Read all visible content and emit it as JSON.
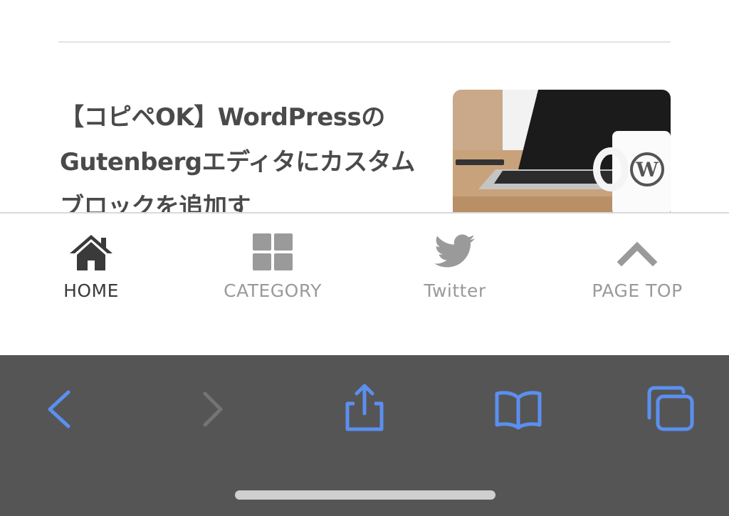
{
  "article": {
    "title": "【コピペOK】WordPressのGutenbergエディタにカスタムブロックを追加す"
  },
  "bottom_nav": {
    "items": [
      {
        "label": "HOME",
        "icon": "home-icon",
        "active": true
      },
      {
        "label": "CATEGORY",
        "icon": "grid-icon",
        "active": false
      },
      {
        "label": "Twitter",
        "icon": "twitter-icon",
        "active": false
      },
      {
        "label": "PAGE TOP",
        "icon": "chevron-up-icon",
        "active": false
      }
    ],
    "active_color": "#3a3a3a",
    "inactive_color": "#9a9a9a"
  },
  "browser_toolbar": {
    "buttons": [
      {
        "name": "back",
        "icon": "chevron-left-icon",
        "enabled": true
      },
      {
        "name": "forward",
        "icon": "chevron-right-icon",
        "enabled": false
      },
      {
        "name": "share",
        "icon": "share-icon",
        "enabled": true
      },
      {
        "name": "bookmarks",
        "icon": "book-icon",
        "enabled": true
      },
      {
        "name": "tabs",
        "icon": "tabs-icon",
        "enabled": true
      }
    ],
    "accent_color": "#5b8ff0",
    "background_color": "#555555"
  }
}
